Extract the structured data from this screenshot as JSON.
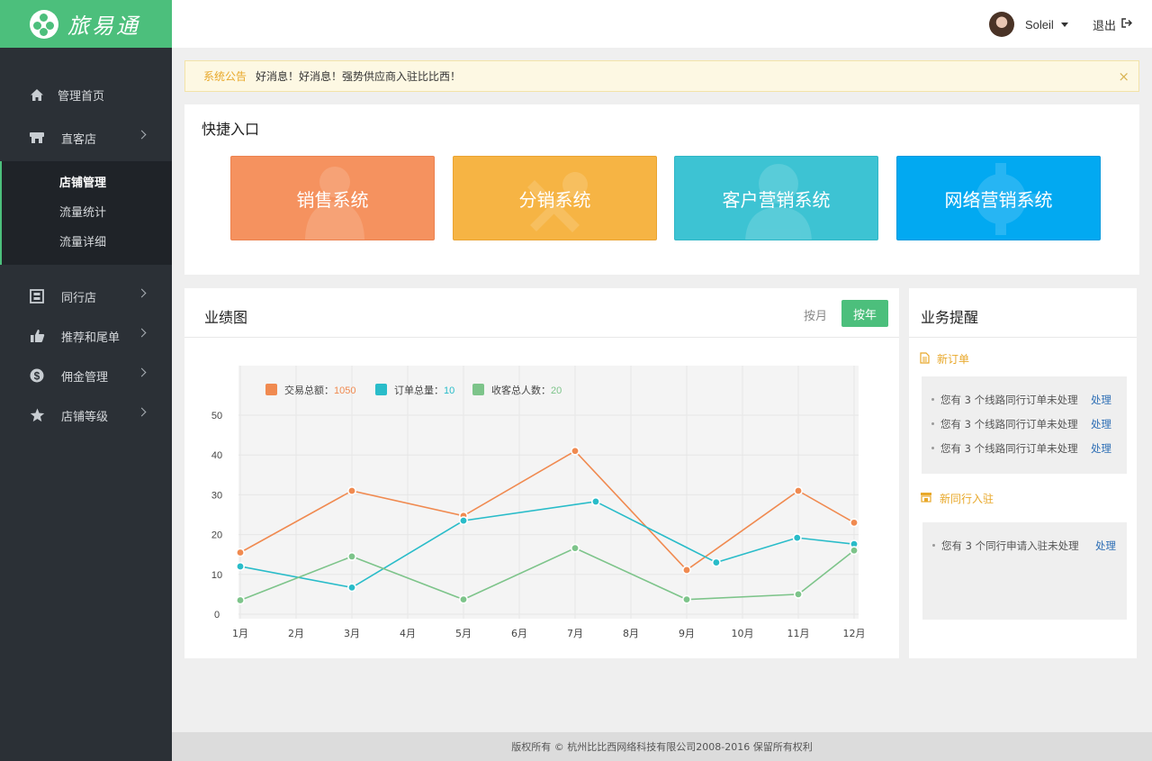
{
  "brand": {
    "name": "旅易通",
    "color": "#4cbf7c"
  },
  "sidebar": {
    "items": [
      {
        "label": "管理首页",
        "icon": "home-icon"
      },
      {
        "label": "直客店",
        "icon": "shop-icon",
        "expanded": true,
        "children": [
          {
            "label": "店铺管理",
            "active": true
          },
          {
            "label": "流量统计"
          },
          {
            "label": "流量详细"
          }
        ]
      },
      {
        "label": "同行店",
        "icon": "building-icon"
      },
      {
        "label": "推荐和尾单",
        "icon": "thumbs-up-icon"
      },
      {
        "label": "佣金管理",
        "icon": "dollar-icon"
      },
      {
        "label": "店铺等级",
        "icon": "star-icon"
      }
    ]
  },
  "header": {
    "user_name": "Soleil",
    "logout_label": "退出"
  },
  "notice": {
    "tag": "系统公告",
    "message": "好消息！好消息！强势供应商入驻比比西！",
    "close": "×"
  },
  "quick": {
    "title": "快捷入口",
    "buttons": [
      {
        "label": "销售系统",
        "color": "#f5925f",
        "icon": "user-group-icon"
      },
      {
        "label": "分销系统",
        "color": "#f6b444",
        "icon": "tools-icon"
      },
      {
        "label": "客户营销系统",
        "color": "#3dc3d3",
        "icon": "user-icon"
      },
      {
        "label": "网络营销系统",
        "color": "#02a9f1",
        "icon": "gear-icon"
      }
    ]
  },
  "performance": {
    "title": "业绩图",
    "toggle_month": "按月",
    "toggle_year": "按年"
  },
  "chart_data": {
    "type": "line",
    "categories": [
      "1月",
      "2月",
      "3月",
      "4月",
      "5月",
      "6月",
      "7月",
      "8月",
      "9月",
      "10月",
      "11月",
      "12月"
    ],
    "ylim": [
      0,
      50
    ],
    "yticks": [
      0,
      10,
      20,
      30,
      40,
      50
    ],
    "grid": true,
    "legend_position": "top-left",
    "series": [
      {
        "name": "交易总额",
        "total": "1050",
        "color": "#f08a50",
        "points": [
          [
            0,
            15.5
          ],
          [
            2,
            31
          ],
          [
            4,
            24.7
          ],
          [
            6,
            41
          ],
          [
            8,
            11.1
          ],
          [
            10,
            31
          ],
          [
            11,
            23
          ]
        ]
      },
      {
        "name": "订单总量",
        "total": "10",
        "color": "#29bcc9",
        "points": [
          [
            0,
            12
          ],
          [
            2,
            6.7
          ],
          [
            4,
            23.5
          ],
          [
            6.37,
            28.3
          ],
          [
            8.53,
            13
          ],
          [
            9.98,
            19.2
          ],
          [
            11,
            17.6
          ]
        ]
      },
      {
        "name": "收客总人数",
        "total": "20",
        "color": "#7dc48a",
        "points": [
          [
            0,
            3.5
          ],
          [
            2,
            14.5
          ],
          [
            4,
            3.7
          ],
          [
            6,
            16.6
          ],
          [
            8,
            3.7
          ],
          [
            10,
            5
          ],
          [
            11,
            16
          ]
        ]
      }
    ]
  },
  "remind": {
    "title": "业务提醒",
    "sections": [
      {
        "title": "新订单",
        "icon": "document-icon",
        "rows": [
          {
            "text": "您有 3 个线路同行订单未处理",
            "action": "处理"
          },
          {
            "text": "您有 3 个线路同行订单未处理",
            "action": "处理"
          },
          {
            "text": "您有 3 个线路同行订单未处理",
            "action": "处理"
          }
        ]
      },
      {
        "title": "新同行入驻",
        "icon": "store-icon",
        "rows": [
          {
            "text": "您有 3 个同行申请入驻未处理",
            "action": "处理"
          }
        ]
      }
    ]
  },
  "footer": {
    "text": "版权所有 © 杭州比比西网络科技有限公司2008-2016 保留所有权利"
  }
}
